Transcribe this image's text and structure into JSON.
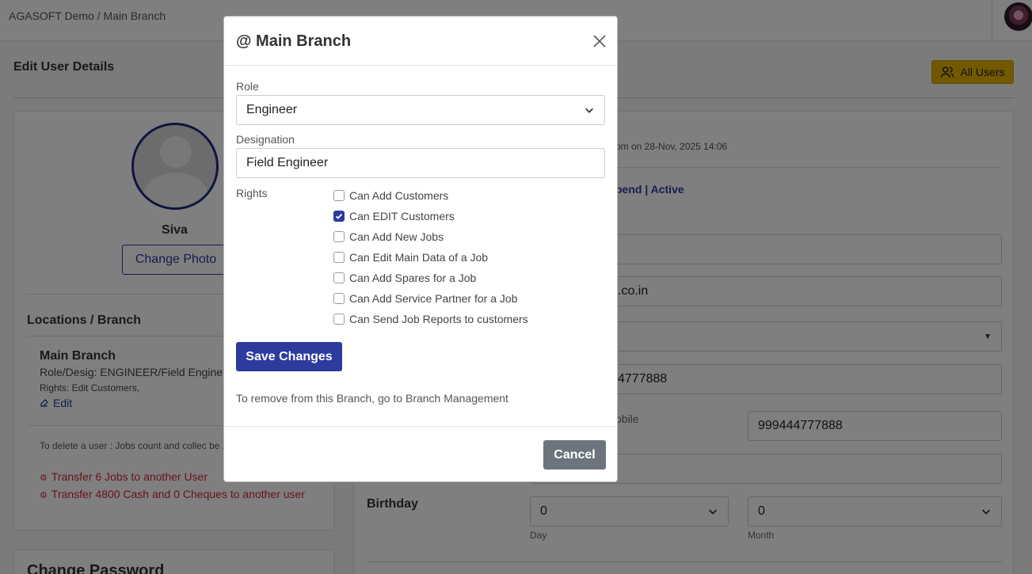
{
  "topbar": {
    "breadcrumb": "AGASOFT Demo / Main Branch"
  },
  "page": {
    "title": "Edit User Details",
    "all_users_label": "All Users",
    "profile": {
      "name": "Siva",
      "change_photo_label": "Change Photo"
    },
    "locations": {
      "heading": "Locations / Branch",
      "branch_name": "Main Branch",
      "role_desig": "Role/Desig: ENGINEER/Field Engine",
      "rights": "Rights: Edit Customers,",
      "edit_label": "Edit"
    },
    "delete_note": "To delete a user : Jobs count and collec be Zero",
    "transfer_jobs": "Transfer 6 Jobs to another User",
    "transfer_cash": "Transfer 4800 Cash and 0 Cheques to another user",
    "change_password_heading": "Change Password",
    "details": {
      "created_fragment": "om on 28-Nov, 2025 14:06",
      "status_fragment": "pend | Active",
      "email_fragment": ".co.in",
      "phone_fragment": "4777888",
      "mobile_label_fragment": "obile",
      "mobile_value": "999444777888",
      "birthday_label": "Birthday",
      "day_value": "0",
      "day_label": "Day",
      "month_value": "0",
      "month_label": "Month"
    }
  },
  "modal": {
    "title": "@ Main Branch",
    "role_label": "Role",
    "role_value": "Engineer",
    "designation_label": "Designation",
    "designation_value": "Field Engineer",
    "rights_label": "Rights",
    "rights": [
      {
        "label": "Can Add Customers",
        "checked": false
      },
      {
        "label": "Can EDIT Customers",
        "checked": true
      },
      {
        "label": "Can Add New Jobs",
        "checked": false
      },
      {
        "label": "Can Edit Main Data of a Job",
        "checked": false
      },
      {
        "label": "Can Add Spares for a Job",
        "checked": false
      },
      {
        "label": "Can Add Service Partner for a Job",
        "checked": false
      },
      {
        "label": "Can Send Job Reports to customers",
        "checked": false
      }
    ],
    "save_label": "Save Changes",
    "remove_note": "To remove from this Branch, go to Branch Management",
    "cancel_label": "Cancel"
  },
  "colors": {
    "primary": "#2d3a9e",
    "accent_yellow": "#e4b200",
    "danger": "#d0263a",
    "secondary": "#6c757d"
  }
}
